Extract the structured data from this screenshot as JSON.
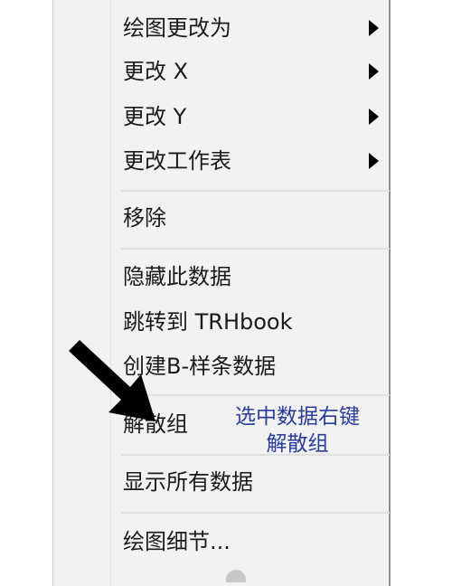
{
  "context_menu": {
    "items": [
      {
        "label": "绘图更改为",
        "has_submenu": true
      },
      {
        "label": "更改 X",
        "has_submenu": true
      },
      {
        "label": "更改 Y",
        "has_submenu": true
      },
      {
        "label": "更改工作表",
        "has_submenu": true
      },
      {
        "label": "移除",
        "has_submenu": false
      },
      {
        "label": "隐藏此数据",
        "has_submenu": false
      },
      {
        "label": "跳转到 TRHbook",
        "has_submenu": false
      },
      {
        "label": "创建B-样条数据",
        "has_submenu": false
      },
      {
        "label": "解散组",
        "has_submenu": false
      },
      {
        "label": "显示所有数据",
        "has_submenu": false
      },
      {
        "label": "绘图细节...",
        "has_submenu": false
      }
    ]
  },
  "annotation": {
    "line1": "选中数据右键",
    "line2": "解散组",
    "color": "#2a3d9a"
  },
  "icons": {
    "submenu": "chevron-right-icon",
    "pointer": "arrow-pointer-icon"
  }
}
